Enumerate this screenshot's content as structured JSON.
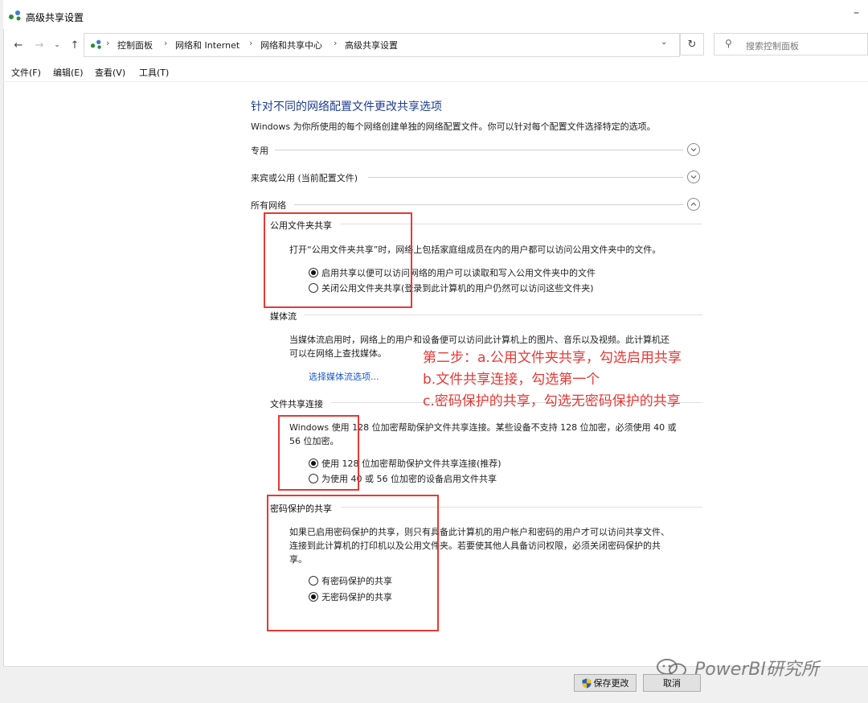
{
  "window": {
    "title": "高级共享设置"
  },
  "address": {
    "crumbs": [
      "控制面板",
      "网络和 Internet",
      "网络和共享中心",
      "高级共享设置"
    ],
    "search_placeholder": "搜索控制面板"
  },
  "menu": [
    "文件(F)",
    "编辑(E)",
    "查看(V)",
    "工具(T)"
  ],
  "main": {
    "heading": "针对不同的网络配置文件更改共享选项",
    "description": "Windows 为你所使用的每个网络创建单独的网络配置文件。你可以针对每个配置文件选择特定的选项。",
    "profiles": [
      {
        "label": "专用",
        "expanded": false
      },
      {
        "label": "来宾或公用 (当前配置文件)",
        "expanded": false
      },
      {
        "label": "所有网络",
        "expanded": true
      }
    ],
    "sections": {
      "public_folder": {
        "label": "公用文件夹共享",
        "text": "打开“公用文件夹共享”时，网络上包括家庭组成员在内的用户都可以访问公用文件夹中的文件。",
        "options": [
          {
            "label": "启用共享以便可以访问网络的用户可以读取和写入公用文件夹中的文件",
            "selected": true
          },
          {
            "label": "关闭公用文件夹共享(登录到此计算机的用户仍然可以访问这些文件夹)",
            "selected": false
          }
        ]
      },
      "media": {
        "label": "媒体流",
        "text_line1": "当媒体流启用时，网络上的用户和设备便可以访问此计算机上的图片、音乐以及视频。此计算机还",
        "text_line2": "可以在网络上查找媒体。",
        "link": "选择媒体流选项..."
      },
      "file_sharing": {
        "label": "文件共享连接",
        "text_line1": "Windows 使用 128 位加密帮助保护文件共享连接。某些设备不支持 128 位加密，必须使用 40 或",
        "text_line2": "56 位加密。",
        "options": [
          {
            "label": "使用 128 位加密帮助保护文件共享连接(推荐)",
            "selected": true
          },
          {
            "label": "为使用 40 或 56 位加密的设备启用文件共享",
            "selected": false
          }
        ]
      },
      "password": {
        "label": "密码保护的共享",
        "text_line1": "如果已启用密码保护的共享，则只有具备此计算机的用户帐户和密码的用户才可以访问共享文件、",
        "text_line2": "连接到此计算机的打印机以及公用文件夹。若要使其他人具备访问权限，必须关闭密码保护的共",
        "text_line3": "享。",
        "options": [
          {
            "label": "有密码保护的共享",
            "selected": false
          },
          {
            "label": "无密码保护的共享",
            "selected": true
          }
        ]
      }
    }
  },
  "annotation": {
    "line1": "第二步：a.公用文件夹共享，勾选启用共享",
    "line2": "b.文件共享连接，勾选第一个",
    "line3": "c.密码保护的共享，勾选无密码保护的共享",
    "color": "#e53935"
  },
  "buttons": {
    "save": "保存更改",
    "cancel": "取消"
  },
  "watermark": "PowerBI研究所",
  "colors": {
    "heading": "#1e3d8f",
    "link": "#1a56c9",
    "accent": "#e53935"
  }
}
